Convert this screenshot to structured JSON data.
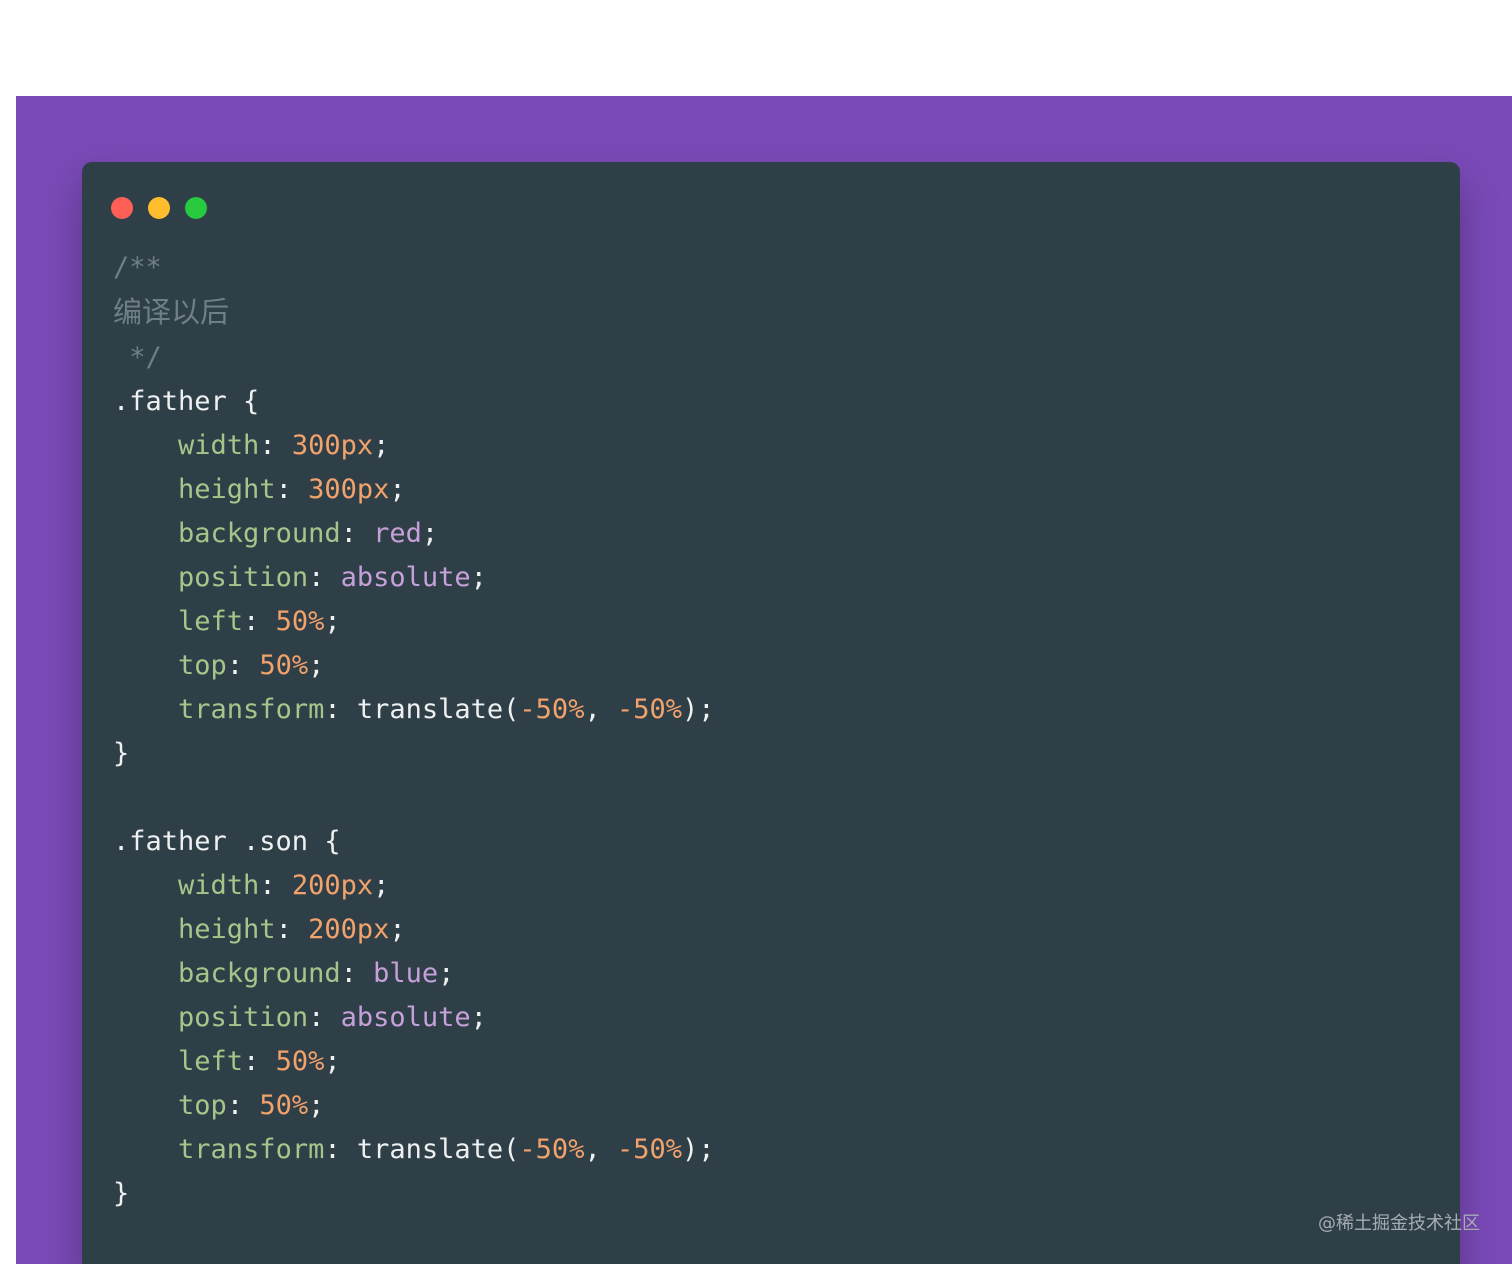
{
  "colors": {
    "page_background": "#ffffff",
    "backdrop": "#7a4ab8",
    "window_background": "#2f3f48",
    "traffic_red": "#ff5f56",
    "traffic_yellow": "#ffbd2e",
    "traffic_green": "#27c93f",
    "comment": "#6f7f86",
    "property": "#a7c48a",
    "number": "#f2a26b",
    "keyword": "#c6a0d8",
    "text": "#eef1f2"
  },
  "window": {
    "controls": [
      {
        "name": "close",
        "icon": "traffic-light-red-icon"
      },
      {
        "name": "minimize",
        "icon": "traffic-light-yellow-icon"
      },
      {
        "name": "maximize",
        "icon": "traffic-light-green-icon"
      }
    ]
  },
  "code": {
    "comment_open": "/**",
    "comment_text": "编译以后",
    "comment_close": " */",
    "blocks": [
      {
        "selector": ".father",
        "open": " {",
        "close": "}",
        "lines": [
          {
            "prop": "width",
            "sep": ": ",
            "value": "300px",
            "value_type": "number",
            "end": ";"
          },
          {
            "prop": "height",
            "sep": ": ",
            "value": "300px",
            "value_type": "number",
            "end": ";"
          },
          {
            "prop": "background",
            "sep": ": ",
            "value": "red",
            "value_type": "keyword",
            "end": ";"
          },
          {
            "prop": "position",
            "sep": ": ",
            "value": "absolute",
            "value_type": "keyword",
            "end": ";"
          },
          {
            "prop": "left",
            "sep": ": ",
            "value": "50%",
            "value_type": "number",
            "end": ";"
          },
          {
            "prop": "top",
            "sep": ": ",
            "value": "50%",
            "value_type": "number",
            "end": ";"
          }
        ],
        "transform": {
          "prop": "transform",
          "sep": ": ",
          "func": "translate(",
          "arg1": "-50%",
          "comma": ", ",
          "arg2": "-50%",
          "end": ");"
        }
      },
      {
        "selector": ".father .son",
        "open": " {",
        "close": "}",
        "lines": [
          {
            "prop": "width",
            "sep": ": ",
            "value": "200px",
            "value_type": "number",
            "end": ";"
          },
          {
            "prop": "height",
            "sep": ": ",
            "value": "200px",
            "value_type": "number",
            "end": ";"
          },
          {
            "prop": "background",
            "sep": ": ",
            "value": "blue",
            "value_type": "keyword",
            "end": ";"
          },
          {
            "prop": "position",
            "sep": ": ",
            "value": "absolute",
            "value_type": "keyword",
            "end": ";"
          },
          {
            "prop": "left",
            "sep": ": ",
            "value": "50%",
            "value_type": "number",
            "end": ";"
          },
          {
            "prop": "top",
            "sep": ": ",
            "value": "50%",
            "value_type": "number",
            "end": ";"
          }
        ],
        "transform": {
          "prop": "transform",
          "sep": ": ",
          "func": "translate(",
          "arg1": "-50%",
          "comma": ", ",
          "arg2": "-50%",
          "end": ");"
        }
      }
    ]
  },
  "watermark": "@稀土掘金技术社区"
}
